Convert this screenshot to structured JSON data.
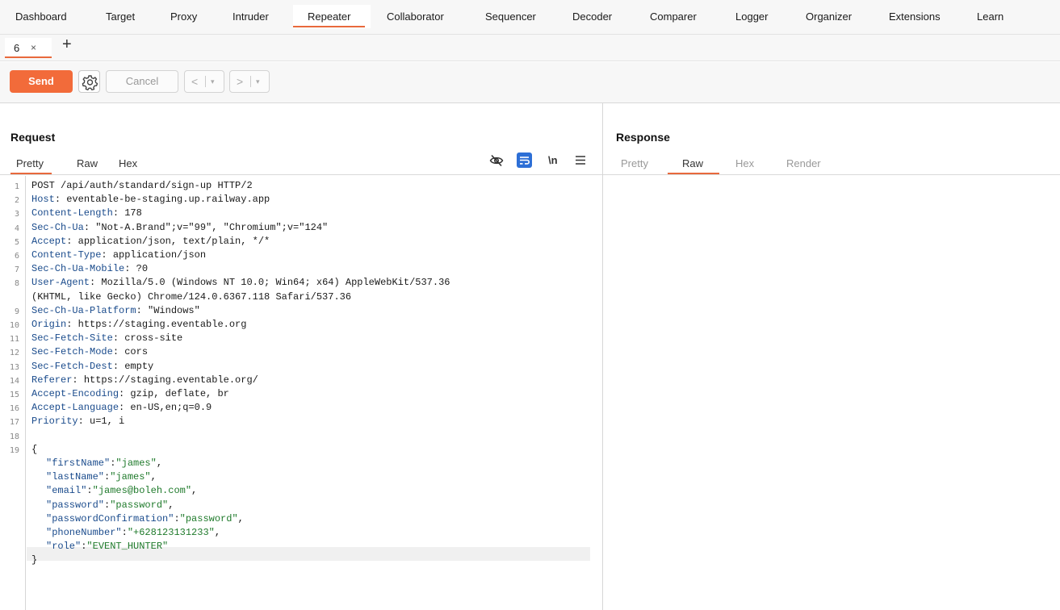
{
  "menu": {
    "tabs": [
      "Dashboard",
      "Target",
      "Proxy",
      "Intruder",
      "Repeater",
      "Collaborator",
      "Sequencer",
      "Decoder",
      "Comparer",
      "Logger",
      "Organizer",
      "Extensions",
      "Learn"
    ],
    "active": "Repeater"
  },
  "repeater_tabs": {
    "tab_label": "6",
    "close_glyph": "×",
    "add_glyph": "+"
  },
  "toolbar": {
    "send_label": "Send",
    "cancel_label": "Cancel",
    "prev_glyph": "<",
    "next_glyph": ">",
    "dropdown_glyph": "▾",
    "settings_icon": "gear-icon"
  },
  "request": {
    "title": "Request",
    "tabs": [
      "Pretty",
      "Raw",
      "Hex"
    ],
    "active_tab": "Pretty",
    "tools": {
      "hide_icon": "eye-slash-icon",
      "wrap_icon": "wrap-lines-icon",
      "newline_label": "\\n",
      "menu_icon": "hamburger-menu-icon"
    },
    "lines": [
      {
        "n": "1",
        "key": "",
        "val": "POST /api/auth/standard/sign-up HTTP/2"
      },
      {
        "n": "2",
        "key": "Host",
        "val": ": eventable-be-staging.up.railway.app"
      },
      {
        "n": "3",
        "key": "Content-Length",
        "val": ": 178"
      },
      {
        "n": "4",
        "key": "Sec-Ch-Ua",
        "val": ": \"Not-A.Brand\";v=\"99\", \"Chromium\";v=\"124\""
      },
      {
        "n": "5",
        "key": "Accept",
        "val": ": application/json, text/plain, */*"
      },
      {
        "n": "6",
        "key": "Content-Type",
        "val": ": application/json"
      },
      {
        "n": "7",
        "key": "Sec-Ch-Ua-Mobile",
        "val": ": ?0"
      },
      {
        "n": "8",
        "key": "User-Agent",
        "val": ": Mozilla/5.0 (Windows NT 10.0; Win64; x64) AppleWebKit/537.36"
      },
      {
        "n": "",
        "key": "",
        "val": "(KHTML, like Gecko) Chrome/124.0.6367.118 Safari/537.36"
      },
      {
        "n": "9",
        "key": "Sec-Ch-Ua-Platform",
        "val": ": \"Windows\""
      },
      {
        "n": "10",
        "key": "Origin",
        "val": ": https://staging.eventable.org"
      },
      {
        "n": "11",
        "key": "Sec-Fetch-Site",
        "val": ": cross-site"
      },
      {
        "n": "12",
        "key": "Sec-Fetch-Mode",
        "val": ": cors"
      },
      {
        "n": "13",
        "key": "Sec-Fetch-Dest",
        "val": ": empty"
      },
      {
        "n": "14",
        "key": "Referer",
        "val": ": https://staging.eventable.org/"
      },
      {
        "n": "15",
        "key": "Accept-Encoding",
        "val": ": gzip, deflate, br"
      },
      {
        "n": "16",
        "key": "Accept-Language",
        "val": ": en-US,en;q=0.9"
      },
      {
        "n": "17",
        "key": "Priority",
        "val": ": u=1, i"
      },
      {
        "n": "18",
        "key": "",
        "val": ""
      },
      {
        "n": "19",
        "key": "",
        "val": "{"
      }
    ],
    "body": [
      {
        "key": "\"firstName\"",
        "sep": ":",
        "val": "\"james\"",
        "tail": ","
      },
      {
        "key": "\"lastName\"",
        "sep": ":",
        "val": "\"james\"",
        "tail": ","
      },
      {
        "key": "\"email\"",
        "sep": ":",
        "val": "\"james@boleh.com\"",
        "tail": ","
      },
      {
        "key": "\"password\"",
        "sep": ":",
        "val": "\"password\"",
        "tail": ","
      },
      {
        "key": "\"passwordConfirmation\"",
        "sep": ":",
        "val": "\"password\"",
        "tail": ","
      },
      {
        "key": "\"phoneNumber\"",
        "sep": ":",
        "val": "\"+628123131233\"",
        "tail": ","
      },
      {
        "key": "\"role\"",
        "sep": ":",
        "val": "\"EVENT_HUNTER\"",
        "tail": ""
      }
    ],
    "closing": "}"
  },
  "response": {
    "title": "Response",
    "tabs": [
      "Pretty",
      "Raw",
      "Hex",
      "Render"
    ],
    "active_tab": "Raw"
  },
  "colors": {
    "accent": "#f26b3a",
    "header_key": "#1a4b8c",
    "json_value": "#1f7a2b"
  }
}
